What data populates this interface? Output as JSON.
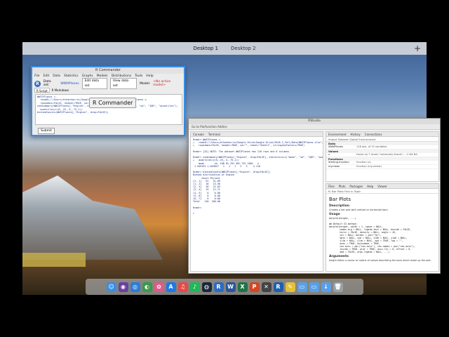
{
  "spaces": {
    "tabs": [
      "Desktop 1",
      "Desktop 2"
    ],
    "add": "+"
  },
  "rcmdr": {
    "title": "R Commander",
    "menu": [
      "File",
      "Edit",
      "Data",
      "Statistics",
      "Graphs",
      "Models",
      "Distributions",
      "Tools",
      "Help"
    ],
    "dataset_label": "Data set:",
    "dataset_value": "WWIIPlanes",
    "edit_btn": "Edit data set",
    "view_btn": "View data set",
    "model_label": "Model:",
    "model_value": "<No active model>",
    "tabs": [
      "R Script",
      "R Markdown"
    ],
    "script": "WWIIPlanes <- \n  readXL(\"/Users/ethanharris/Google ...lve/2018-2_Fall/Data/WWIIPlanes.x\n  rownames=FALSE, header=TRUE, na=\"\", ...ngsAsFactors=TRUE)\nnumSummary(WWIIPlanes[,\"Engine\", drop=FALSE], statistics=c(\"mean\", \"sd\", \"IQR\", \"quantiles\"),\n  quantiles=c(0,.25,.5,.75,1))\nbinnedCounts(WWIIPlanes[,\"Engine\", drop=FALSE])",
    "submit": "Submit",
    "tooltip": "R Commander"
  },
  "rstudio": {
    "title": "RStudio",
    "toolbar": "Go to file/function    Addins",
    "console_tabs": [
      "Console",
      "Terminal"
    ],
    "console": "Rcmdr> WWIIPlanes <- \n+   readXL(\"/Users/ethanharris/Google Drive/Google Drive/2018-2_Fall/Data/WWIIPlanes.xlsx\",\n+   rownames=FALSE, header=TRUE, na=\"\", sheet=\"Sheet1\", stringsAsFactors=TRUE)\n\nRcmdr> [32] NOTE: The dataset WWIIPlanes has 118 rows and 6 columns.\n\nRcmdr> numSummary(WWIIPlanes[,\"Engine\", drop=FALSE], statistics=c(\"mean\", \"sd\", \"IQR\", \"quantiles\"),\n+   quantiles=c(0,.25,.5,.75,1))\n    mean       sd  IQR 0% 25% 50% 75% 100%   n\n 1.949153 1.049627   1   1   1   2   3    4 118\n\nRcmdr> binnedCounts(WWIIPlanes[,\"Engine\", drop=FALSE])\nBinned distribution of Engine\n      Count Percent\n[1, 1]   61   51.69\n(1, 2]   16   13.56\n(2, 3]   26   22.03\n(3, 4]   15   12.71\n(4, 5]    0    0.00\n(5, 6]    0    0.00\n(6, 7]    0    0.00\nTotal   118  100.00\n\nRcmdr> \n\n>",
    "env_tabs": [
      "Environment",
      "History",
      "Connections"
    ],
    "env_tools": "Import Dataset    Global Environment",
    "env_data_header": "Data",
    "env_rows": [
      {
        "k": "WWIIPlanes",
        "v": "118 obs. of 10 variables"
      }
    ],
    "env_values_header": "Values",
    "env_values": [
      {
        "k": "x",
        "v": "Factor w/ 7 levels \"extremely liberal\",..: 2 NA NA"
      }
    ],
    "env_functions_header": "Functions",
    "env_functions": [
      {
        "k": "Sterling.function",
        "v": "function (x)"
      },
      {
        "k": "my.mean",
        "v": "function (my.vector)"
      }
    ],
    "help_tabs": [
      "Files",
      "Plots",
      "Packages",
      "Help",
      "Viewer"
    ],
    "help_tools": "R: Bar Plots    Find in Topic",
    "help": {
      "title": "Bar Plots",
      "desc_h": "Description",
      "desc": "Creates a bar plot with vertical or horizontal bars.",
      "usage_h": "Usage",
      "usage": "barplot(height, ...)\n\n## Default S3 method:\nbarplot(height, width = 1, space = NULL,\n        names.arg = NULL, legend.text = NULL, beside = FALSE,\n        horiz = FALSE, density = NULL, angle = 45,\n        col = NULL, border = par(\"fg\"),\n        main = NULL, sub = NULL, xlab = NULL, ylab = NULL,\n        xlim = NULL, ylim = NULL, xpd = TRUE, log = \"\",\n        axes = TRUE, axisnames = TRUE,\n        cex.axis = par(\"cex.axis\"), cex.names = par(\"cex.axis\"),\n        inside = TRUE, plot = TRUE, axis.lty = 0, offset = 0,\n        add = FALSE, args.legend = NULL, ...)",
      "args_h": "Arguments",
      "args": "height    either a vector or matrix of values describing the bars which make up the plot."
    }
  },
  "dock": {
    "icons": [
      {
        "name": "finder-icon",
        "glyph": "☺",
        "color": "#3b8ee0"
      },
      {
        "name": "siri-icon",
        "glyph": "◉",
        "color": "#6b3fa0"
      },
      {
        "name": "safari-icon",
        "glyph": "◎",
        "color": "#2a7ed8"
      },
      {
        "name": "chrome-icon",
        "glyph": "◐",
        "color": "#3a9a48"
      },
      {
        "name": "photos-icon",
        "glyph": "✿",
        "color": "#e05a8a"
      },
      {
        "name": "appstore-icon",
        "glyph": "A",
        "color": "#1e78e6"
      },
      {
        "name": "music-icon",
        "glyph": "♫",
        "color": "#e64a4a"
      },
      {
        "name": "spotify-icon",
        "glyph": "♪",
        "color": "#1db954"
      },
      {
        "name": "steam-icon",
        "glyph": "◍",
        "color": "#1b2838"
      },
      {
        "name": "r-icon",
        "glyph": "R",
        "color": "#2d6cc0"
      },
      {
        "name": "word-icon",
        "glyph": "W",
        "color": "#2b579a"
      },
      {
        "name": "excel-icon",
        "glyph": "X",
        "color": "#217346"
      },
      {
        "name": "powerpoint-icon",
        "glyph": "P",
        "color": "#d24726"
      },
      {
        "name": "xquartz-icon",
        "glyph": "✕",
        "color": "#444444"
      },
      {
        "name": "r-icon-2",
        "glyph": "R",
        "color": "#1f5fae"
      },
      {
        "name": "notes-icon",
        "glyph": "✎",
        "color": "#e3c23a"
      },
      {
        "name": "folder-icon",
        "glyph": "▭",
        "color": "#5aa0e6"
      },
      {
        "name": "folder-icon-2",
        "glyph": "▭",
        "color": "#5aa0e6"
      },
      {
        "name": "downloads-icon",
        "glyph": "↓",
        "color": "#5aa0e6"
      },
      {
        "name": "trash-icon",
        "glyph": "🗑",
        "color": "#9aa0a6"
      }
    ]
  }
}
